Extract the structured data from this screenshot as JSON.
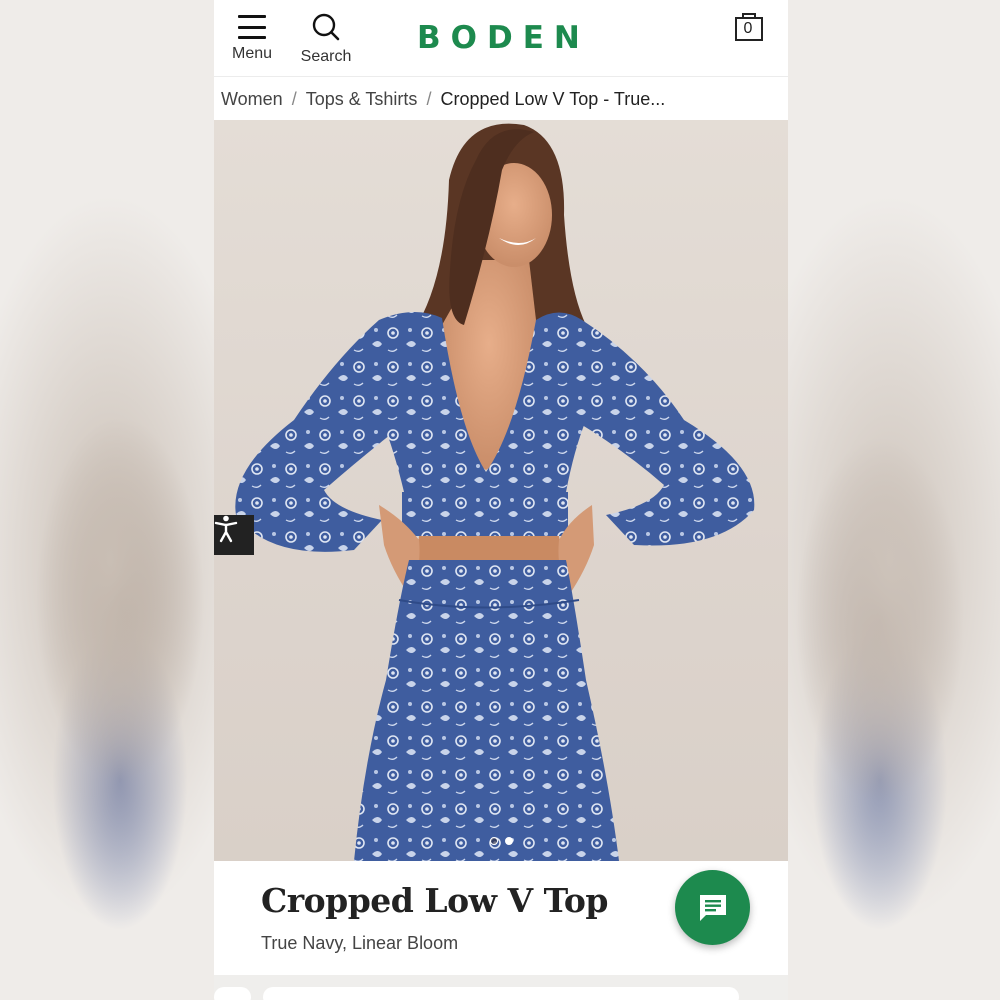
{
  "header": {
    "menu_label": "Menu",
    "search_label": "Search",
    "logo_text": "BODEN",
    "bag_count": "0"
  },
  "breadcrumb": {
    "items": [
      "Women",
      "Tops & Tshirts",
      "Cropped Low V Top - True..."
    ],
    "separator": "/"
  },
  "gallery": {
    "image_count": 2,
    "active_index": 1
  },
  "product": {
    "title": "Cropped Low V Top",
    "color": "True Navy, Linear Bloom"
  },
  "icons": {
    "menu": "hamburger-icon",
    "search": "search-icon",
    "bag": "shopping-bag-icon",
    "accessibility": "accessibility-icon",
    "chat": "chat-icon"
  },
  "colors": {
    "brand": "#1d8a4e",
    "text": "#222222"
  }
}
